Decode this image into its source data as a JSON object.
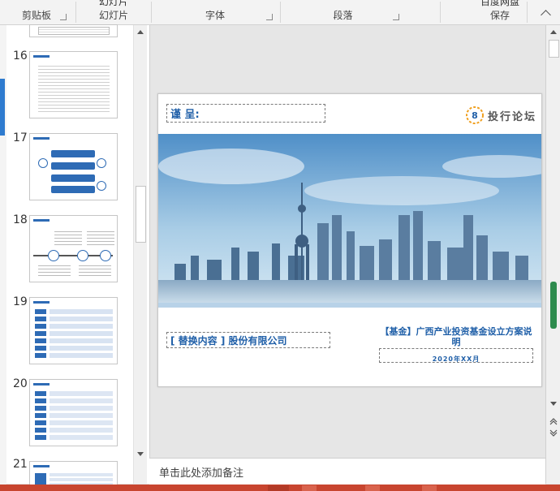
{
  "ribbon": {
    "groups": [
      {
        "label": "剪贴板"
      },
      {
        "label": "幻灯片",
        "top": "幻灯片"
      },
      {
        "label": "字体"
      },
      {
        "label": "段落"
      },
      {
        "label": "保存",
        "top": "百度网盘"
      }
    ]
  },
  "thumbnails": [
    {
      "num": "16"
    },
    {
      "num": "17"
    },
    {
      "num": "18"
    },
    {
      "num": "19"
    },
    {
      "num": "20"
    },
    {
      "num": "21"
    }
  ],
  "slide": {
    "header_text": "谨 呈:",
    "brand_text": "投行论坛",
    "company_text": "[ 替换内容 ] 股份有限公司",
    "title_text": "【基金】广西产业投资基金设立方案说明",
    "date_text": "2020年XX月"
  },
  "notes": {
    "placeholder": "单击此处添加备注"
  },
  "colors": {
    "accent": "#1f5fa8",
    "status_bar": "#c8452f",
    "skyline_sky": "#8bbfe0"
  }
}
